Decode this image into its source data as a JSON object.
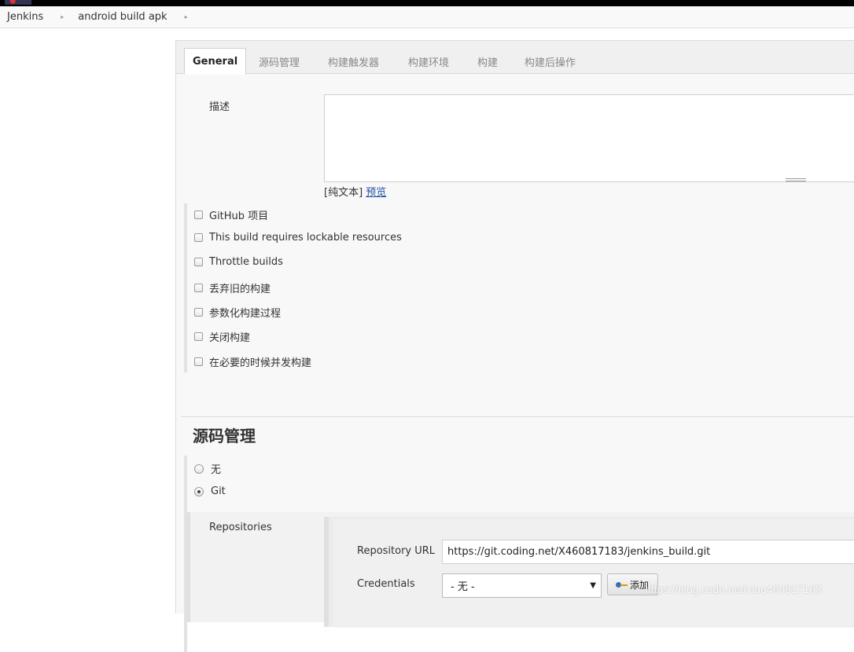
{
  "breadcrumb": {
    "items": [
      "Jenkins",
      "android build apk"
    ],
    "separator": "▸"
  },
  "tabs": [
    "General",
    "源码管理",
    "构建触发器",
    "构建环境",
    "构建",
    "构建后操作"
  ],
  "description": {
    "label": "描述",
    "plain_text": "[纯文本]",
    "preview": "预览"
  },
  "options": [
    "GitHub 项目",
    "This build requires lockable resources",
    "Throttle builds",
    "丢弃旧的构建",
    "参数化构建过程",
    "关闭构建",
    "在必要的时候并发构建"
  ],
  "scm": {
    "title": "源码管理",
    "options": [
      "无",
      "Git"
    ],
    "selected": "Git",
    "repositories_label": "Repositories",
    "repo_url_label": "Repository URL",
    "repo_url_value": "https://git.coding.net/X460817183/jenkins_build.git",
    "credentials_label": "Credentials",
    "credentials_value": "- 无 -",
    "add_label": "添加"
  },
  "watermark": "https://blog.csdn.net/xiao460817183",
  "colors": {
    "link": "#2050a0",
    "panel_bg": "#f8f8f8",
    "topbar": "#000000"
  }
}
